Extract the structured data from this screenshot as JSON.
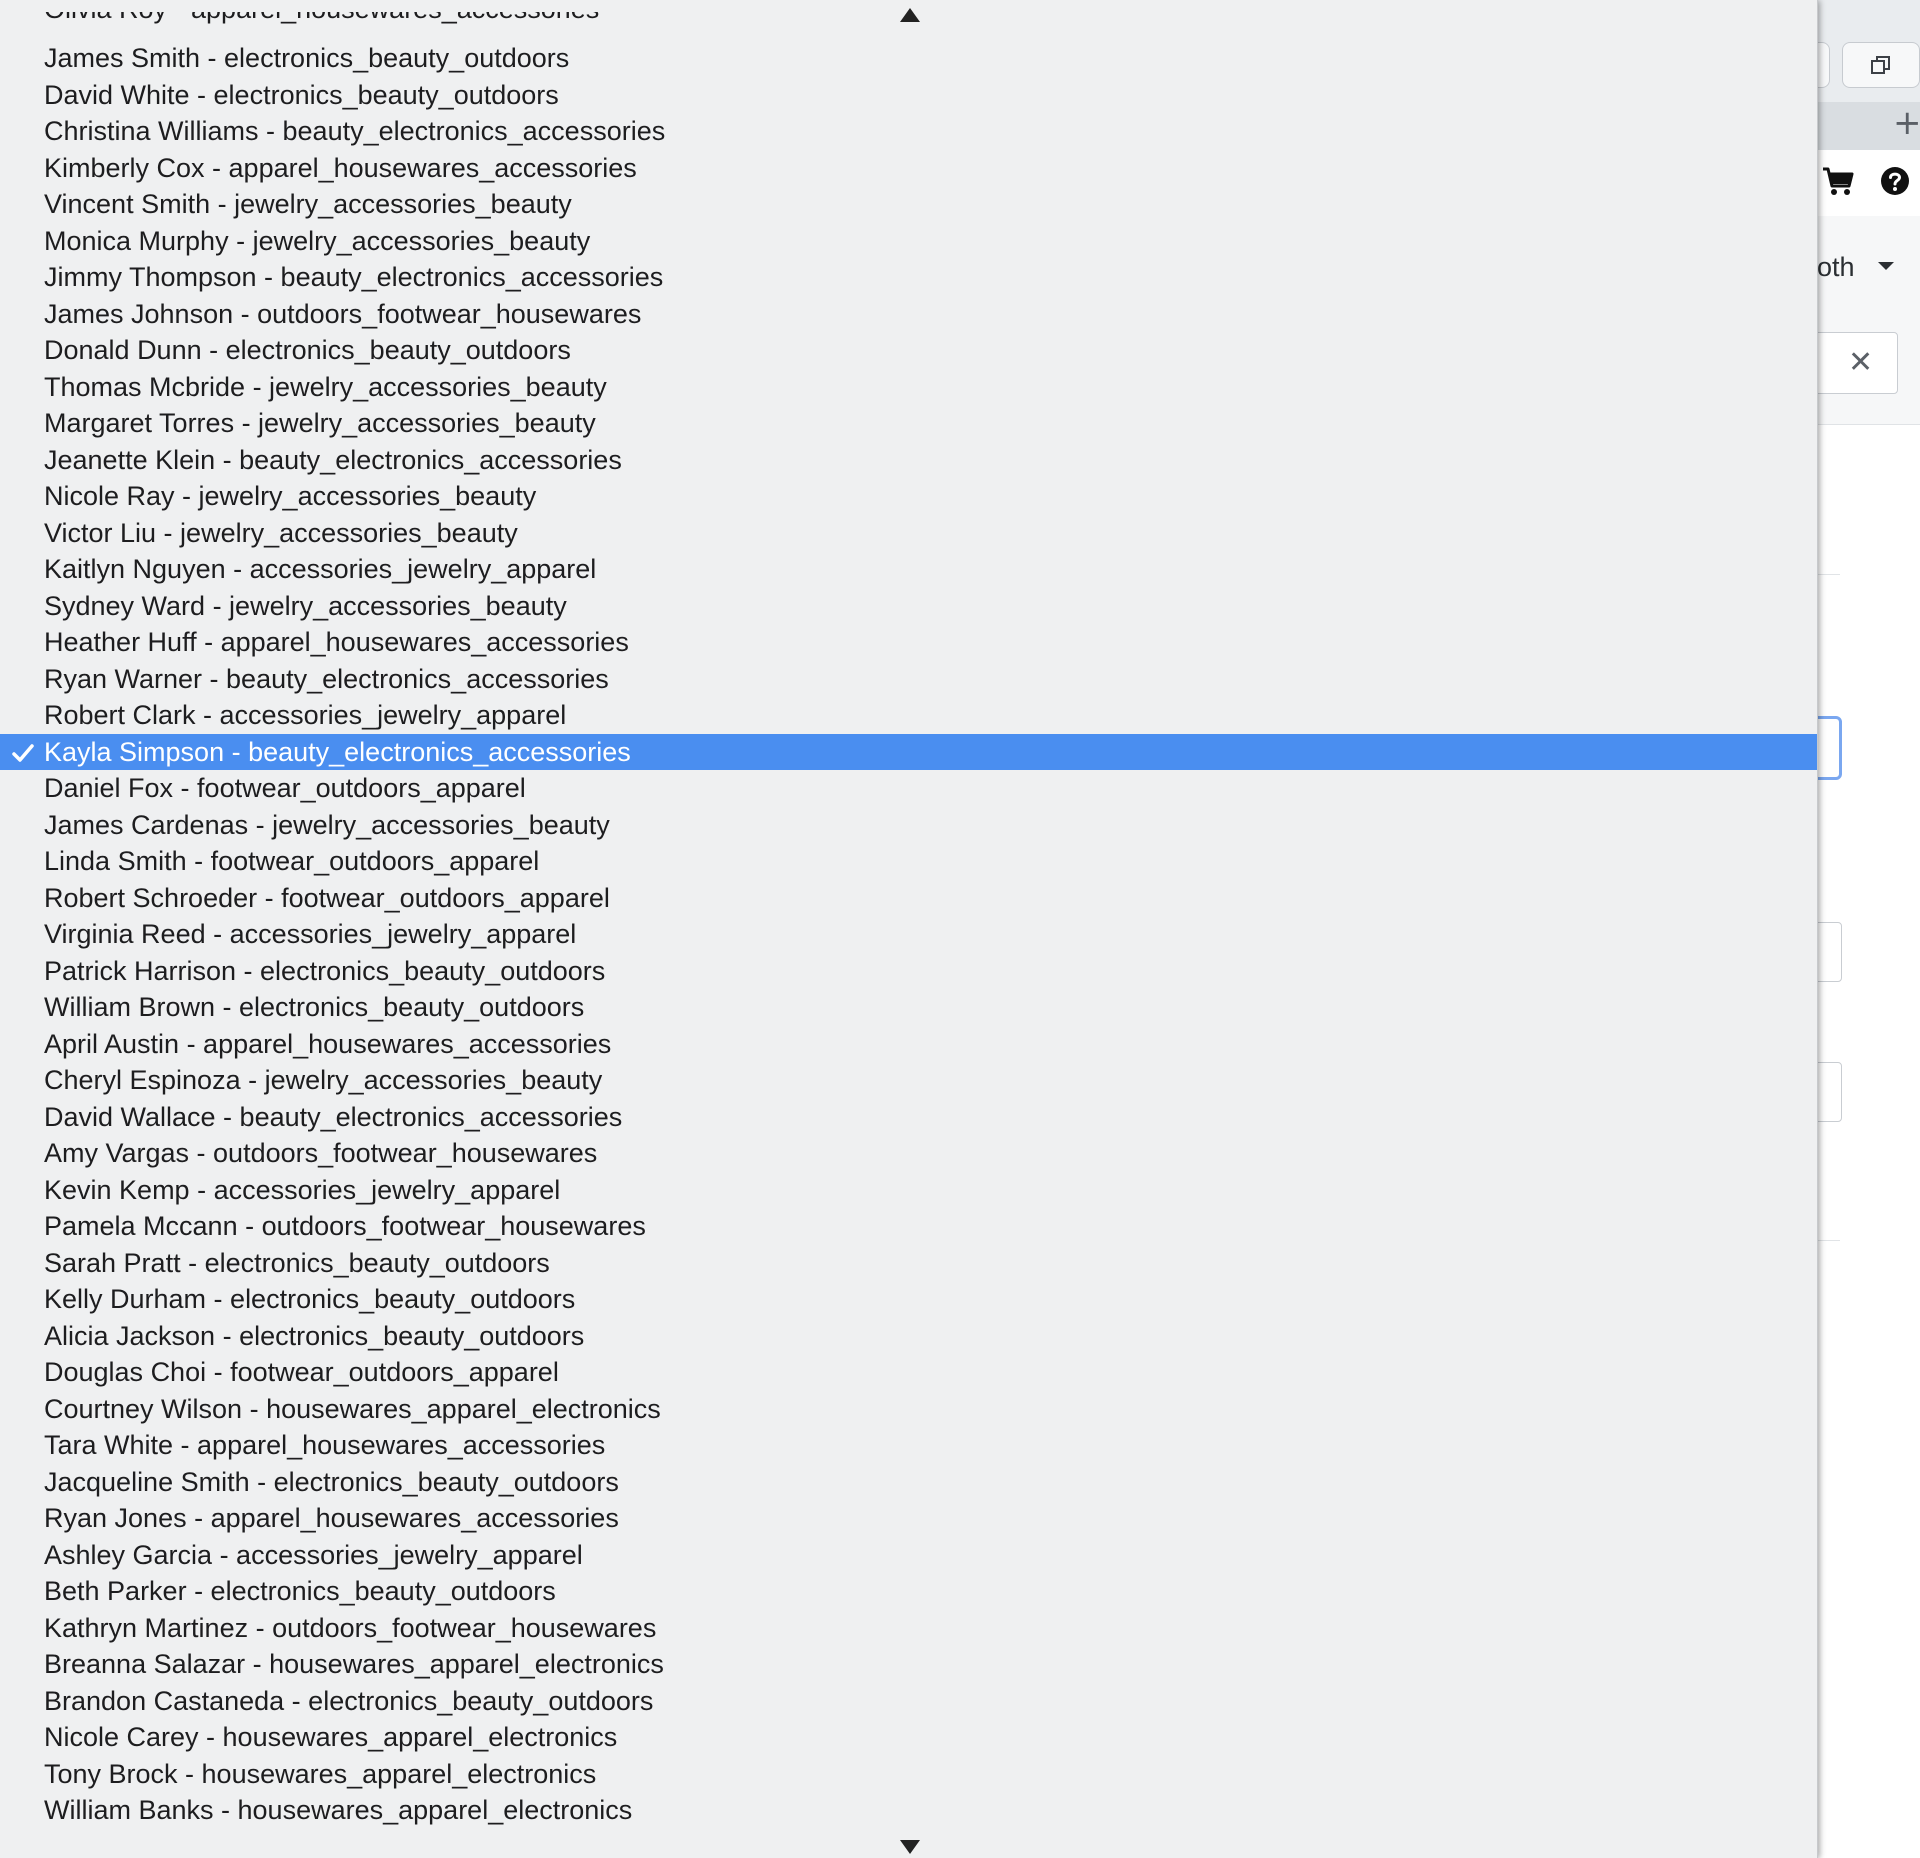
{
  "background": {
    "toolbar": {
      "both_label": "both",
      "icons": [
        "restore-window-icon",
        "new-tab-plus-icon",
        "shopping-cart-icon",
        "help-icon",
        "close-icon",
        "chevron-down-icon"
      ]
    }
  },
  "dropdown": {
    "partial_top_option": "Olivia Roy - apparel_housewares_accessories",
    "selected_index": 19,
    "options": [
      "James Smith - electronics_beauty_outdoors",
      "David White - electronics_beauty_outdoors",
      "Christina Williams - beauty_electronics_accessories",
      "Kimberly Cox - apparel_housewares_accessories",
      "Vincent Smith - jewelry_accessories_beauty",
      "Monica Murphy - jewelry_accessories_beauty",
      "Jimmy Thompson - beauty_electronics_accessories",
      "James Johnson - outdoors_footwear_housewares",
      "Donald Dunn - electronics_beauty_outdoors",
      "Thomas Mcbride - jewelry_accessories_beauty",
      "Margaret Torres - jewelry_accessories_beauty",
      "Jeanette Klein - beauty_electronics_accessories",
      "Nicole Ray - jewelry_accessories_beauty",
      "Victor Liu - jewelry_accessories_beauty",
      "Kaitlyn Nguyen - accessories_jewelry_apparel",
      "Sydney Ward - jewelry_accessories_beauty",
      "Heather Huff - apparel_housewares_accessories",
      "Ryan Warner - beauty_electronics_accessories",
      "Robert Clark - accessories_jewelry_apparel",
      "Kayla Simpson - beauty_electronics_accessories",
      "Daniel Fox - footwear_outdoors_apparel",
      "James Cardenas - jewelry_accessories_beauty",
      "Linda Smith - footwear_outdoors_apparel",
      "Robert Schroeder - footwear_outdoors_apparel",
      "Virginia Reed - accessories_jewelry_apparel",
      "Patrick Harrison - electronics_beauty_outdoors",
      "William Brown - electronics_beauty_outdoors",
      "April Austin - apparel_housewares_accessories",
      "Cheryl Espinoza - jewelry_accessories_beauty",
      "David Wallace - beauty_electronics_accessories",
      "Amy Vargas - outdoors_footwear_housewares",
      "Kevin Kemp - accessories_jewelry_apparel",
      "Pamela Mccann - outdoors_footwear_housewares",
      "Sarah Pratt - electronics_beauty_outdoors",
      "Kelly Durham - electronics_beauty_outdoors",
      "Alicia Jackson - electronics_beauty_outdoors",
      "Douglas Choi - footwear_outdoors_apparel",
      "Courtney Wilson - housewares_apparel_electronics",
      "Tara White - apparel_housewares_accessories",
      "Jacqueline Smith - electronics_beauty_outdoors",
      "Ryan Jones - apparel_housewares_accessories",
      "Ashley Garcia - accessories_jewelry_apparel",
      "Beth Parker - electronics_beauty_outdoors",
      "Kathryn Martinez - outdoors_footwear_housewares",
      "Breanna Salazar - housewares_apparel_electronics",
      "Brandon Castaneda - electronics_beauty_outdoors",
      "Nicole Carey - housewares_apparel_electronics",
      "Tony Brock - housewares_apparel_electronics",
      "William Banks - housewares_apparel_electronics"
    ],
    "icons": {
      "scroll_up": "triangle-up-icon",
      "scroll_down": "triangle-down-icon",
      "selected_marker": "checkmark-icon"
    }
  },
  "colors": {
    "selection": "#4a8ef0",
    "menu_background": "#eff0f1",
    "text": "#1d1d1f",
    "accent": "#2f6fd6"
  }
}
